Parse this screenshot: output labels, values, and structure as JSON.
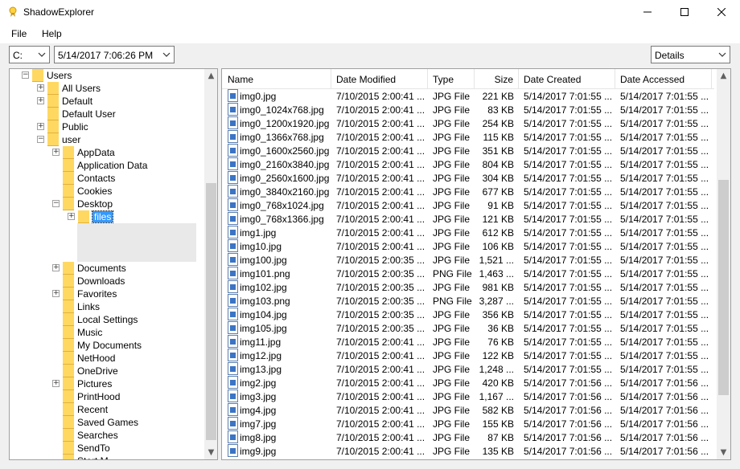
{
  "window": {
    "title": "ShadowExplorer"
  },
  "menu": {
    "file": "File",
    "help": "Help"
  },
  "toolbar": {
    "drive": "C:",
    "snapshot": "5/14/2017 7:06:26 PM",
    "view": "Details"
  },
  "tree": [
    {
      "label": "Users",
      "indent": 0,
      "expander": "−"
    },
    {
      "label": "All Users",
      "indent": 1,
      "expander": "+"
    },
    {
      "label": "Default",
      "indent": 1,
      "expander": "+"
    },
    {
      "label": "Default User",
      "indent": 1,
      "expander": ""
    },
    {
      "label": "Public",
      "indent": 1,
      "expander": "+"
    },
    {
      "label": "user",
      "indent": 1,
      "expander": "−"
    },
    {
      "label": "AppData",
      "indent": 2,
      "expander": "+"
    },
    {
      "label": "Application Data",
      "indent": 2,
      "expander": ""
    },
    {
      "label": "Contacts",
      "indent": 2,
      "expander": ""
    },
    {
      "label": "Cookies",
      "indent": 2,
      "expander": ""
    },
    {
      "label": "Desktop",
      "indent": 2,
      "expander": "−"
    },
    {
      "label": "files",
      "indent": 3,
      "expander": "+",
      "selected": true
    },
    {
      "label": "",
      "indent": 3,
      "expander": "",
      "hidden": true
    },
    {
      "label": "",
      "indent": 3,
      "expander": "",
      "hidden": true
    },
    {
      "label": "",
      "indent": 3,
      "expander": "",
      "hidden": true
    },
    {
      "label": "Documents",
      "indent": 2,
      "expander": "+"
    },
    {
      "label": "Downloads",
      "indent": 2,
      "expander": ""
    },
    {
      "label": "Favorites",
      "indent": 2,
      "expander": "+"
    },
    {
      "label": "Links",
      "indent": 2,
      "expander": ""
    },
    {
      "label": "Local Settings",
      "indent": 2,
      "expander": ""
    },
    {
      "label": "Music",
      "indent": 2,
      "expander": ""
    },
    {
      "label": "My Documents",
      "indent": 2,
      "expander": ""
    },
    {
      "label": "NetHood",
      "indent": 2,
      "expander": ""
    },
    {
      "label": "OneDrive",
      "indent": 2,
      "expander": ""
    },
    {
      "label": "Pictures",
      "indent": 2,
      "expander": "+"
    },
    {
      "label": "PrintHood",
      "indent": 2,
      "expander": ""
    },
    {
      "label": "Recent",
      "indent": 2,
      "expander": ""
    },
    {
      "label": "Saved Games",
      "indent": 2,
      "expander": ""
    },
    {
      "label": "Searches",
      "indent": 2,
      "expander": ""
    },
    {
      "label": "SendTo",
      "indent": 2,
      "expander": ""
    },
    {
      "label": "Start M...",
      "indent": 2,
      "expander": ""
    }
  ],
  "columns": [
    {
      "key": "name",
      "label": "Name"
    },
    {
      "key": "modified",
      "label": "Date Modified"
    },
    {
      "key": "type",
      "label": "Type"
    },
    {
      "key": "size",
      "label": "Size"
    },
    {
      "key": "created",
      "label": "Date Created"
    },
    {
      "key": "accessed",
      "label": "Date Accessed"
    }
  ],
  "files": [
    {
      "name": "img0.jpg",
      "modified": "7/10/2015 2:00:41 ...",
      "type": "JPG File",
      "size": "221 KB",
      "created": "5/14/2017 7:01:55 ...",
      "accessed": "5/14/2017 7:01:55 ..."
    },
    {
      "name": "img0_1024x768.jpg",
      "modified": "7/10/2015 2:00:41 ...",
      "type": "JPG File",
      "size": "83 KB",
      "created": "5/14/2017 7:01:55 ...",
      "accessed": "5/14/2017 7:01:55 ..."
    },
    {
      "name": "img0_1200x1920.jpg",
      "modified": "7/10/2015 2:00:41 ...",
      "type": "JPG File",
      "size": "254 KB",
      "created": "5/14/2017 7:01:55 ...",
      "accessed": "5/14/2017 7:01:55 ..."
    },
    {
      "name": "img0_1366x768.jpg",
      "modified": "7/10/2015 2:00:41 ...",
      "type": "JPG File",
      "size": "115 KB",
      "created": "5/14/2017 7:01:55 ...",
      "accessed": "5/14/2017 7:01:55 ..."
    },
    {
      "name": "img0_1600x2560.jpg",
      "modified": "7/10/2015 2:00:41 ...",
      "type": "JPG File",
      "size": "351 KB",
      "created": "5/14/2017 7:01:55 ...",
      "accessed": "5/14/2017 7:01:55 ..."
    },
    {
      "name": "img0_2160x3840.jpg",
      "modified": "7/10/2015 2:00:41 ...",
      "type": "JPG File",
      "size": "804 KB",
      "created": "5/14/2017 7:01:55 ...",
      "accessed": "5/14/2017 7:01:55 ..."
    },
    {
      "name": "img0_2560x1600.jpg",
      "modified": "7/10/2015 2:00:41 ...",
      "type": "JPG File",
      "size": "304 KB",
      "created": "5/14/2017 7:01:55 ...",
      "accessed": "5/14/2017 7:01:55 ..."
    },
    {
      "name": "img0_3840x2160.jpg",
      "modified": "7/10/2015 2:00:41 ...",
      "type": "JPG File",
      "size": "677 KB",
      "created": "5/14/2017 7:01:55 ...",
      "accessed": "5/14/2017 7:01:55 ..."
    },
    {
      "name": "img0_768x1024.jpg",
      "modified": "7/10/2015 2:00:41 ...",
      "type": "JPG File",
      "size": "91 KB",
      "created": "5/14/2017 7:01:55 ...",
      "accessed": "5/14/2017 7:01:55 ..."
    },
    {
      "name": "img0_768x1366.jpg",
      "modified": "7/10/2015 2:00:41 ...",
      "type": "JPG File",
      "size": "121 KB",
      "created": "5/14/2017 7:01:55 ...",
      "accessed": "5/14/2017 7:01:55 ..."
    },
    {
      "name": "img1.jpg",
      "modified": "7/10/2015 2:00:41 ...",
      "type": "JPG File",
      "size": "612 KB",
      "created": "5/14/2017 7:01:55 ...",
      "accessed": "5/14/2017 7:01:55 ..."
    },
    {
      "name": "img10.jpg",
      "modified": "7/10/2015 2:00:41 ...",
      "type": "JPG File",
      "size": "106 KB",
      "created": "5/14/2017 7:01:55 ...",
      "accessed": "5/14/2017 7:01:55 ..."
    },
    {
      "name": "img100.jpg",
      "modified": "7/10/2015 2:00:35 ...",
      "type": "JPG File",
      "size": "1,521 ...",
      "created": "5/14/2017 7:01:55 ...",
      "accessed": "5/14/2017 7:01:55 ..."
    },
    {
      "name": "img101.png",
      "modified": "7/10/2015 2:00:35 ...",
      "type": "PNG File",
      "size": "1,463 ...",
      "created": "5/14/2017 7:01:55 ...",
      "accessed": "5/14/2017 7:01:55 ..."
    },
    {
      "name": "img102.jpg",
      "modified": "7/10/2015 2:00:35 ...",
      "type": "JPG File",
      "size": "981 KB",
      "created": "5/14/2017 7:01:55 ...",
      "accessed": "5/14/2017 7:01:55 ..."
    },
    {
      "name": "img103.png",
      "modified": "7/10/2015 2:00:35 ...",
      "type": "PNG File",
      "size": "3,287 ...",
      "created": "5/14/2017 7:01:55 ...",
      "accessed": "5/14/2017 7:01:55 ..."
    },
    {
      "name": "img104.jpg",
      "modified": "7/10/2015 2:00:35 ...",
      "type": "JPG File",
      "size": "356 KB",
      "created": "5/14/2017 7:01:55 ...",
      "accessed": "5/14/2017 7:01:55 ..."
    },
    {
      "name": "img105.jpg",
      "modified": "7/10/2015 2:00:35 ...",
      "type": "JPG File",
      "size": "36 KB",
      "created": "5/14/2017 7:01:55 ...",
      "accessed": "5/14/2017 7:01:55 ..."
    },
    {
      "name": "img11.jpg",
      "modified": "7/10/2015 2:00:41 ...",
      "type": "JPG File",
      "size": "76 KB",
      "created": "5/14/2017 7:01:55 ...",
      "accessed": "5/14/2017 7:01:55 ..."
    },
    {
      "name": "img12.jpg",
      "modified": "7/10/2015 2:00:41 ...",
      "type": "JPG File",
      "size": "122 KB",
      "created": "5/14/2017 7:01:55 ...",
      "accessed": "5/14/2017 7:01:55 ..."
    },
    {
      "name": "img13.jpg",
      "modified": "7/10/2015 2:00:41 ...",
      "type": "JPG File",
      "size": "1,248 ...",
      "created": "5/14/2017 7:01:55 ...",
      "accessed": "5/14/2017 7:01:55 ..."
    },
    {
      "name": "img2.jpg",
      "modified": "7/10/2015 2:00:41 ...",
      "type": "JPG File",
      "size": "420 KB",
      "created": "5/14/2017 7:01:56 ...",
      "accessed": "5/14/2017 7:01:56 ..."
    },
    {
      "name": "img3.jpg",
      "modified": "7/10/2015 2:00:41 ...",
      "type": "JPG File",
      "size": "1,167 ...",
      "created": "5/14/2017 7:01:56 ...",
      "accessed": "5/14/2017 7:01:56 ..."
    },
    {
      "name": "img4.jpg",
      "modified": "7/10/2015 2:00:41 ...",
      "type": "JPG File",
      "size": "582 KB",
      "created": "5/14/2017 7:01:56 ...",
      "accessed": "5/14/2017 7:01:56 ..."
    },
    {
      "name": "img7.jpg",
      "modified": "7/10/2015 2:00:41 ...",
      "type": "JPG File",
      "size": "155 KB",
      "created": "5/14/2017 7:01:56 ...",
      "accessed": "5/14/2017 7:01:56 ..."
    },
    {
      "name": "img8.jpg",
      "modified": "7/10/2015 2:00:41 ...",
      "type": "JPG File",
      "size": "87 KB",
      "created": "5/14/2017 7:01:56 ...",
      "accessed": "5/14/2017 7:01:56 ..."
    },
    {
      "name": "img9.jpg",
      "modified": "7/10/2015 2:00:41 ...",
      "type": "JPG File",
      "size": "135 KB",
      "created": "5/14/2017 7:01:56 ...",
      "accessed": "5/14/2017 7:01:56 ..."
    }
  ]
}
